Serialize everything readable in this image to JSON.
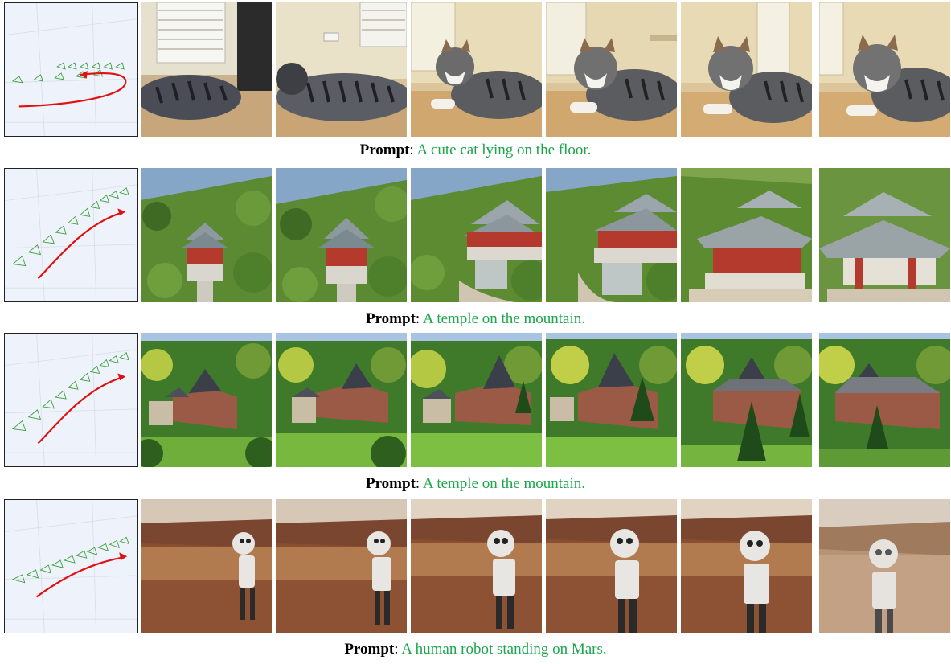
{
  "rows": [
    {
      "id": "cat",
      "caption": {
        "keyword": "Prompt",
        "separator": ": ",
        "text": "A cute cat lying on the floor."
      },
      "scene": "cat-on-floor",
      "frames": 6,
      "trajectory": "loop-left-return"
    },
    {
      "id": "temple-1",
      "caption": {
        "keyword": "Prompt",
        "separator": ": ",
        "text": "A temple on the mountain."
      },
      "scene": "temple-on-hillside",
      "frames": 6,
      "trajectory": "diagonal-up-right"
    },
    {
      "id": "temple-2",
      "caption": {
        "keyword": "Prompt",
        "separator": ": ",
        "text": "A temple on the mountain."
      },
      "scene": "castle-in-forest",
      "frames": 6,
      "trajectory": "diagonal-up-right"
    },
    {
      "id": "robot",
      "caption": {
        "keyword": "Prompt",
        "separator": ": ",
        "text": "A human robot standing on Mars."
      },
      "scene": "robot-on-mars",
      "frames": 6,
      "trajectory": "shallow-up-right"
    }
  ],
  "colors": {
    "prompt_text": "#1aa64a",
    "trajectory_arrow": "#e01010",
    "camera_frustum": "#3fa03f"
  }
}
